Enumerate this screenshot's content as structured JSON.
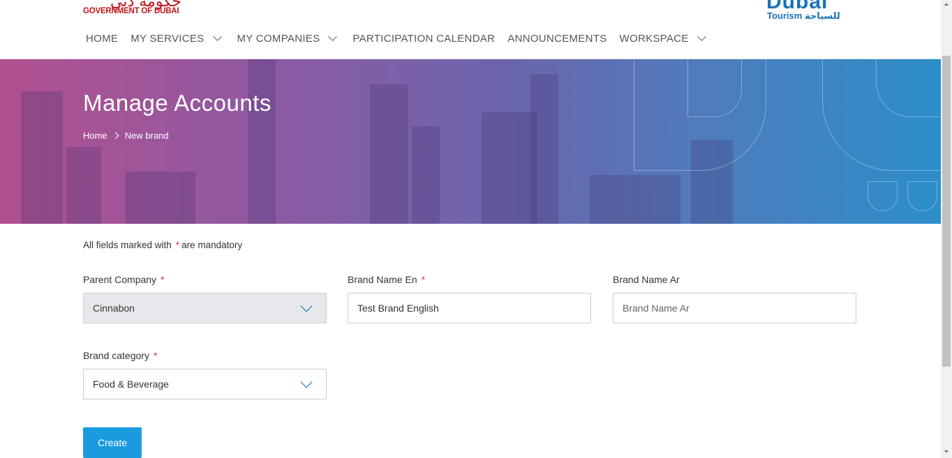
{
  "header": {
    "gov_logo_ar": "حكومة دبي",
    "gov_logo_en": "GOVERNMENT OF DUBAI",
    "tourism_logo_big": "Dubai",
    "tourism_logo_small": "Tourism للسياحة"
  },
  "nav": {
    "items": [
      {
        "label": "HOME",
        "dropdown": false
      },
      {
        "label": "MY SERVICES",
        "dropdown": true
      },
      {
        "label": "MY COMPANIES",
        "dropdown": true
      },
      {
        "label": "PARTICIPATION CALENDAR",
        "dropdown": false
      },
      {
        "label": "ANNOUNCEMENTS",
        "dropdown": false
      },
      {
        "label": "WORKSPACE",
        "dropdown": true
      }
    ]
  },
  "hero": {
    "title": "Manage Accounts",
    "breadcrumb": {
      "home": "Home",
      "current": "New brand"
    }
  },
  "form": {
    "mandatory_prefix": "All fields marked with",
    "mandatory_star": "*",
    "mandatory_suffix": "are mandatory",
    "parent_company": {
      "label": "Parent Company",
      "required": "*",
      "value": "Cinnabon"
    },
    "brand_name_en": {
      "label": "Brand Name En",
      "required": "*",
      "value": "Test Brand English"
    },
    "brand_name_ar": {
      "label": "Brand Name Ar",
      "placeholder": "Brand Name Ar",
      "value": ""
    },
    "brand_category": {
      "label": "Brand category",
      "required": "*",
      "value": "Food & Beverage"
    },
    "create_label": "Create"
  },
  "colors": {
    "primary": "#1a9be0",
    "required": "#c0392b",
    "gov_red": "#c3141c",
    "tourism_blue": "#1a73b8"
  }
}
